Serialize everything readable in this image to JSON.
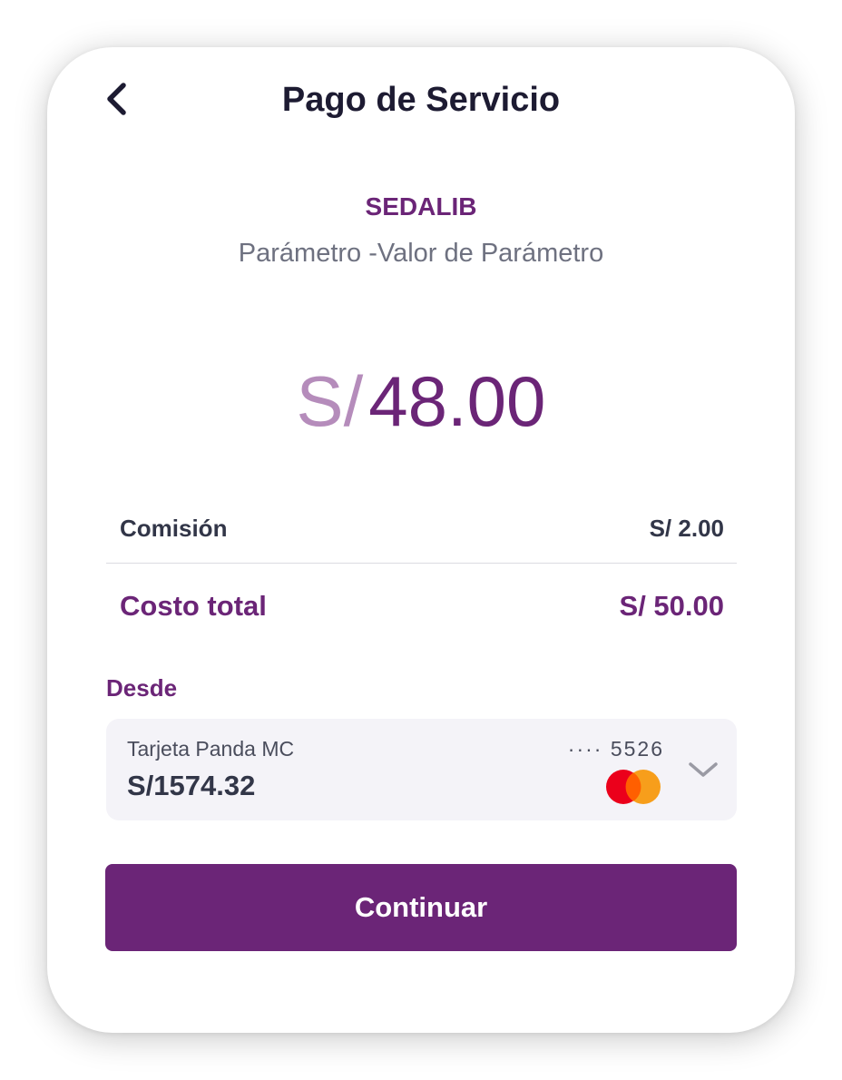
{
  "header": {
    "title": "Pago de Servicio",
    "back_icon": "chevron-left-icon"
  },
  "service": {
    "provider": "SEDALIB",
    "parameter": "Parámetro -Valor de Parámetro"
  },
  "amount": {
    "currency": "S/",
    "value": "48.00"
  },
  "summary": {
    "commission_label": "Comisión",
    "commission_value": "S/ 2.00",
    "total_label": "Costo total",
    "total_value": "S/ 50.00"
  },
  "source": {
    "label": "Desde",
    "card_name": "Tarjeta Panda MC",
    "card_number": "···· 5526",
    "balance": "S/1574.32",
    "card_brand_icon": "mastercard-icon",
    "dropdown_icon": "chevron-down-icon"
  },
  "actions": {
    "continue_label": "Continuar"
  },
  "colors": {
    "brand": "#6b2577",
    "currency_light": "#b58cbb",
    "title_dark": "#1d1b32",
    "muted_text": "#6e7180",
    "card_bg": "#f4f3f8"
  }
}
